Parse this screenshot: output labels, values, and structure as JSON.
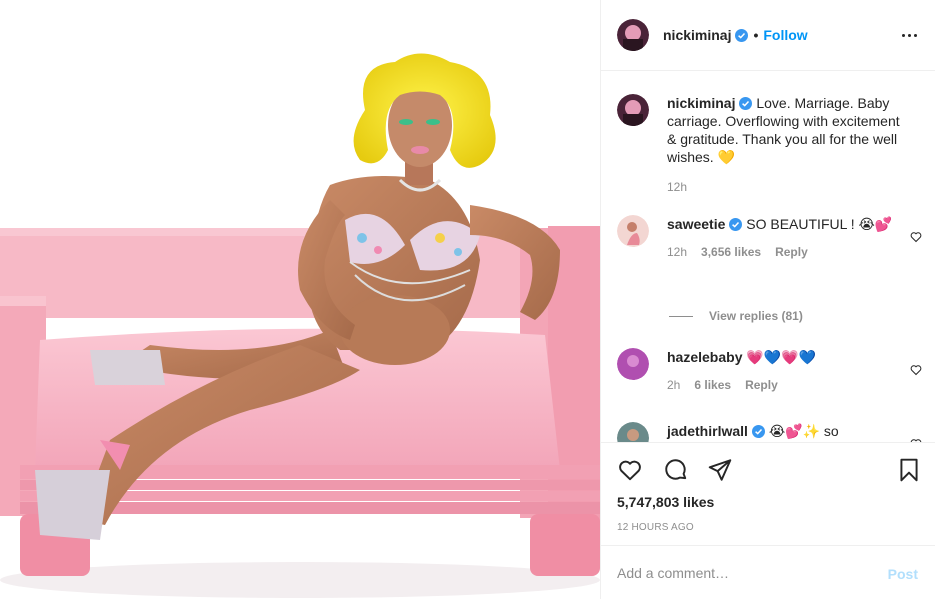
{
  "header": {
    "username": "nickiminaj",
    "dot": "•",
    "follow_label": "Follow"
  },
  "caption": {
    "username": "nickiminaj",
    "text": "Love. Marriage. Baby carriage. Overflowing with excitement & gratitude. Thank you all for the well wishes. 💛",
    "time": "12h"
  },
  "comments": [
    {
      "username": "saweetie",
      "text": "SO BEAUTIFUL ! 😭💕",
      "time": "12h",
      "likes": "3,656 likes",
      "reply_label": "Reply",
      "avatar_color": "#e8b4b0"
    },
    {
      "username": "hazelebaby",
      "text": "💗💙💗💙",
      "time": "2h",
      "likes": "6 likes",
      "reply_label": "Reply",
      "avatar_color": "#b04fb0"
    },
    {
      "username": "jadethirlwall",
      "text": "😭💕✨ so",
      "avatar_color": "#6a8a8a"
    }
  ],
  "view_replies_label": "View replies (81)",
  "likes_count": "5,747,803 likes",
  "timestamp": "12 HOURS AGO",
  "add_comment": {
    "placeholder": "Add a comment…",
    "post_label": "Post"
  },
  "colors": {
    "accent": "#0095f6",
    "verified": "#3897f0",
    "muted": "#8e8e8e",
    "couch_pink": "#f4a6b6",
    "wig_yellow": "#f6e21c"
  },
  "icons": [
    "heart-icon",
    "comment-icon",
    "share-icon",
    "bookmark-icon",
    "more-options-icon",
    "verified-badge-icon"
  ]
}
